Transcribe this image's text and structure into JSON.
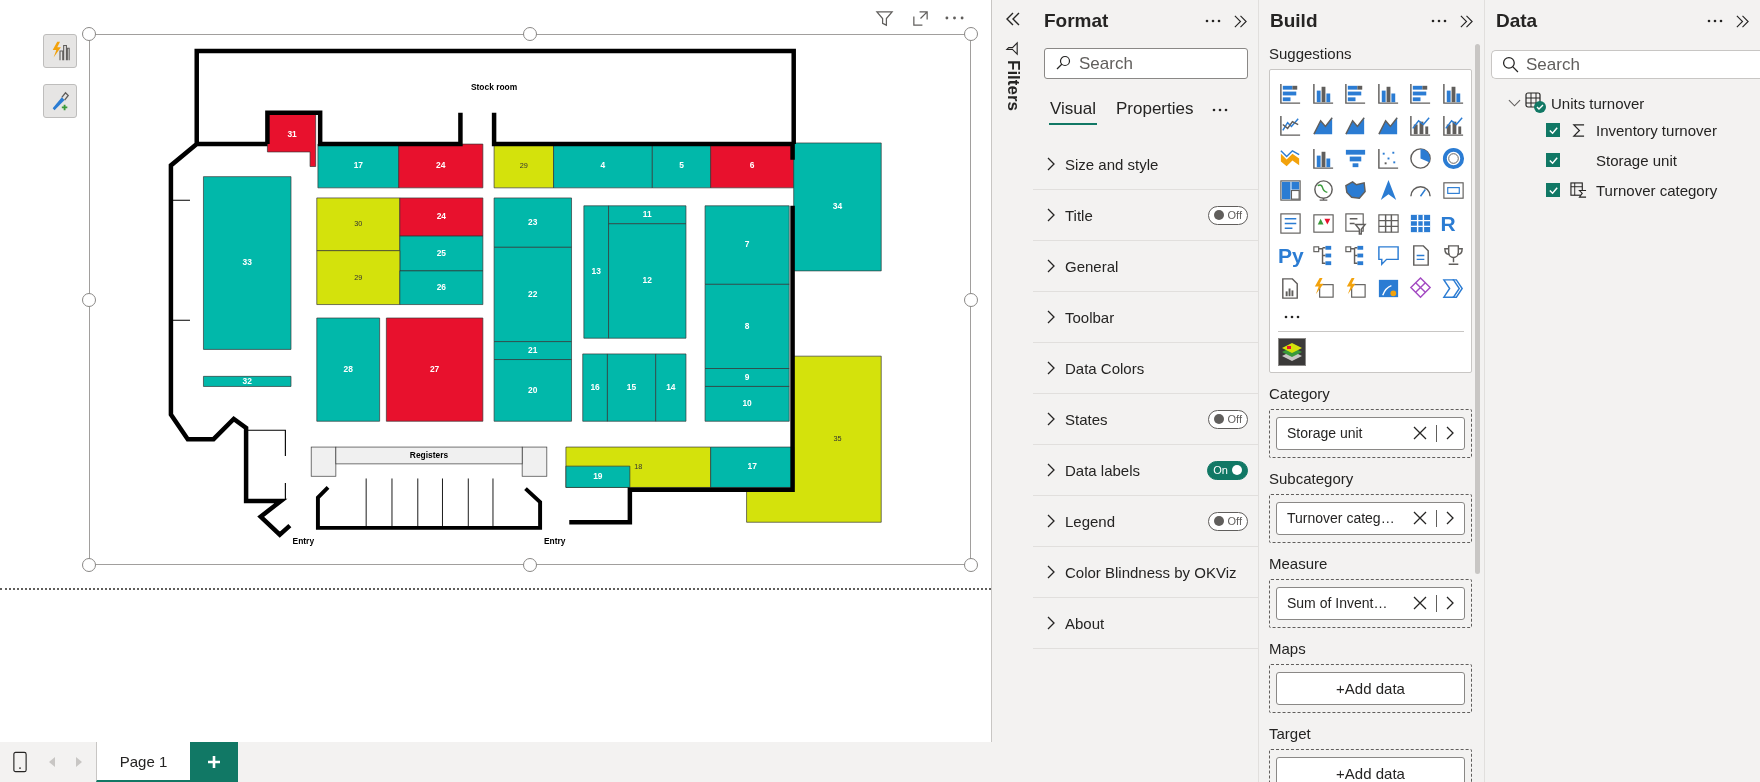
{
  "floor_plan": {
    "labels": {
      "stock_room": "Stock room",
      "registers": "Registers",
      "entries": [
        "Entry",
        "Entry"
      ]
    },
    "units": [
      {
        "label": "31",
        "color": "#e8112d"
      },
      {
        "label": "17",
        "color": "#01b8aa"
      },
      {
        "label": "24",
        "color": "#e8112d"
      },
      {
        "label": "29",
        "color": "#d4e20c"
      },
      {
        "label": "4",
        "color": "#01b8aa"
      },
      {
        "label": "5",
        "color": "#01b8aa"
      },
      {
        "label": "6",
        "color": "#e8112d"
      },
      {
        "label": "34",
        "color": "#01b8aa"
      },
      {
        "label": "33",
        "color": "#01b8aa"
      },
      {
        "label": "30",
        "color": "#d4e20c"
      },
      {
        "label": "24",
        "color": "#e8112d"
      },
      {
        "label": "25",
        "color": "#01b8aa"
      },
      {
        "label": "29",
        "color": "#d4e20c"
      },
      {
        "label": "26",
        "color": "#01b8aa"
      },
      {
        "label": "23",
        "color": "#01b8aa"
      },
      {
        "label": "22",
        "color": "#01b8aa"
      },
      {
        "label": "21",
        "color": "#01b8aa"
      },
      {
        "label": "20",
        "color": "#01b8aa"
      },
      {
        "label": "13",
        "color": "#01b8aa"
      },
      {
        "label": "11",
        "color": "#01b8aa"
      },
      {
        "label": "12",
        "color": "#01b8aa"
      },
      {
        "label": "7",
        "color": "#01b8aa"
      },
      {
        "label": "8",
        "color": "#01b8aa"
      },
      {
        "label": "9",
        "color": "#01b8aa"
      },
      {
        "label": "10",
        "color": "#01b8aa"
      },
      {
        "label": "28",
        "color": "#01b8aa"
      },
      {
        "label": "27",
        "color": "#e8112d"
      },
      {
        "label": "16",
        "color": "#01b8aa"
      },
      {
        "label": "15",
        "color": "#01b8aa"
      },
      {
        "label": "14",
        "color": "#01b8aa"
      },
      {
        "label": "32",
        "color": "#01b8aa"
      },
      {
        "label": "35",
        "color": "#d4e20c"
      },
      {
        "label": "18",
        "color": "#d4e20c"
      },
      {
        "label": "19",
        "color": "#01b8aa"
      },
      {
        "label": "17",
        "color": "#01b8aa"
      }
    ]
  },
  "filters": {
    "label": "Filters"
  },
  "format_pane": {
    "title": "Format",
    "search": {
      "placeholder": "Search"
    },
    "tabs": [
      {
        "label": "Visual",
        "selected": true
      },
      {
        "label": "Properties",
        "selected": false
      }
    ],
    "sections": [
      {
        "label": "Size and style"
      },
      {
        "label": "Title",
        "toggle": {
          "on": false,
          "text": "Off"
        }
      },
      {
        "label": "General"
      },
      {
        "label": "Toolbar"
      },
      {
        "label": "Data Colors"
      },
      {
        "label": "States",
        "toggle": {
          "on": false,
          "text": "Off"
        }
      },
      {
        "label": "Data labels",
        "toggle": {
          "on": true,
          "text": "On"
        }
      },
      {
        "label": "Legend",
        "toggle": {
          "on": false,
          "text": "Off"
        }
      },
      {
        "label": "Color Blindness by OKViz"
      },
      {
        "label": "About"
      }
    ]
  },
  "build_pane": {
    "title": "Build",
    "suggestions_label": "Suggestions",
    "visuals": [
      {
        "kind": "hbar"
      },
      {
        "kind": "vbar"
      },
      {
        "kind": "hbar"
      },
      {
        "kind": "vbar"
      },
      {
        "kind": "hbar"
      },
      {
        "kind": "vbar"
      },
      {
        "kind": "line"
      },
      {
        "kind": "area"
      },
      {
        "kind": "area"
      },
      {
        "kind": "area"
      },
      {
        "kind": "combo"
      },
      {
        "kind": "combo"
      },
      {
        "kind": "ribbon"
      },
      {
        "kind": "vbar"
      },
      {
        "kind": "funnel"
      },
      {
        "kind": "scatter"
      },
      {
        "kind": "pie"
      },
      {
        "kind": "donut"
      },
      {
        "kind": "treemap"
      },
      {
        "kind": "globe"
      },
      {
        "kind": "shapemap"
      },
      {
        "kind": "arrow"
      },
      {
        "kind": "gauge"
      },
      {
        "kind": "card"
      },
      {
        "kind": "list"
      },
      {
        "kind": "kpi"
      },
      {
        "kind": "slicer"
      },
      {
        "kind": "table"
      },
      {
        "kind": "matrix"
      },
      {
        "kind": "script",
        "text": "R"
      },
      {
        "kind": "script",
        "text": "Py"
      },
      {
        "kind": "tree"
      },
      {
        "kind": "tree"
      },
      {
        "kind": "bubble"
      },
      {
        "kind": "document"
      },
      {
        "kind": "trophy"
      },
      {
        "kind": "paginated"
      },
      {
        "kind": "bolt"
      },
      {
        "kind": "bolt"
      },
      {
        "kind": "pin"
      },
      {
        "kind": "diamond"
      },
      {
        "kind": "chevrons"
      }
    ],
    "wells": [
      {
        "label": "Category",
        "kind": "field",
        "value": "Storage unit"
      },
      {
        "label": "Subcategory",
        "kind": "field",
        "value": "Turnover categ…"
      },
      {
        "label": "Measure",
        "kind": "field",
        "value": "Sum of Invent…"
      },
      {
        "label": "Maps",
        "kind": "add",
        "value": "+Add data"
      },
      {
        "label": "Target",
        "kind": "add",
        "value": "+Add data"
      }
    ]
  },
  "data_pane": {
    "title": "Data",
    "search": {
      "placeholder": "Search"
    },
    "table": {
      "name": "Units turnover",
      "expanded": true,
      "fields": [
        {
          "name": "Inventory turnover",
          "checked": true,
          "kind": "measure"
        },
        {
          "name": "Storage unit",
          "checked": true,
          "kind": "column"
        },
        {
          "name": "Turnover category",
          "checked": true,
          "kind": "calculated"
        }
      ]
    }
  },
  "pages": [
    {
      "label": "Page 1",
      "selected": true
    }
  ]
}
